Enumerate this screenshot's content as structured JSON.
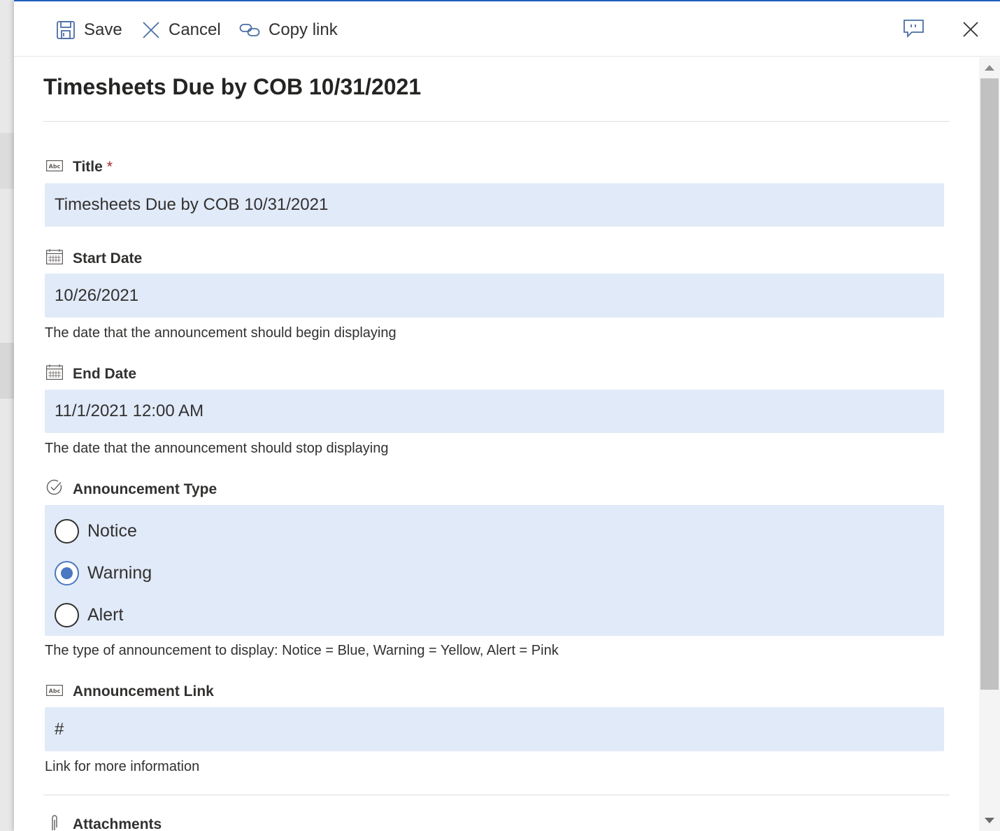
{
  "toolbar": {
    "save_label": "Save",
    "cancel_label": "Cancel",
    "copy_link_label": "Copy link"
  },
  "page_title": "Timesheets Due by COB 10/31/2021",
  "fields": {
    "title": {
      "label": "Title",
      "required_marker": "*",
      "value": "Timesheets Due by COB 10/31/2021"
    },
    "start_date": {
      "label": "Start Date",
      "value": "10/26/2021",
      "help": "The date that the announcement should begin displaying"
    },
    "end_date": {
      "label": "End Date",
      "value": "11/1/2021 12:00 AM",
      "help": "The date that the announcement should stop displaying"
    },
    "announcement_type": {
      "label": "Announcement Type",
      "options": [
        "Notice",
        "Warning",
        "Alert"
      ],
      "selected": "Warning",
      "help": "The type of announcement to display: Notice = Blue, Warning = Yellow, Alert = Pink"
    },
    "announcement_link": {
      "label": "Announcement Link",
      "value": "#",
      "help": "Link for more information"
    },
    "attachments": {
      "label": "Attachments"
    }
  },
  "colors": {
    "field_background": "#e1eaf8",
    "accent": "#4a78c2",
    "required": "#a4262c",
    "top_border": "#1f5fbf"
  },
  "icons": {
    "save": "save-icon",
    "cancel": "x-icon",
    "copy_link": "link-icon",
    "feedback": "feedback-icon",
    "close": "close-icon",
    "text_field": "text-field-icon",
    "calendar": "calendar-icon",
    "choice": "check-circle-icon",
    "attachment": "paperclip-icon"
  }
}
